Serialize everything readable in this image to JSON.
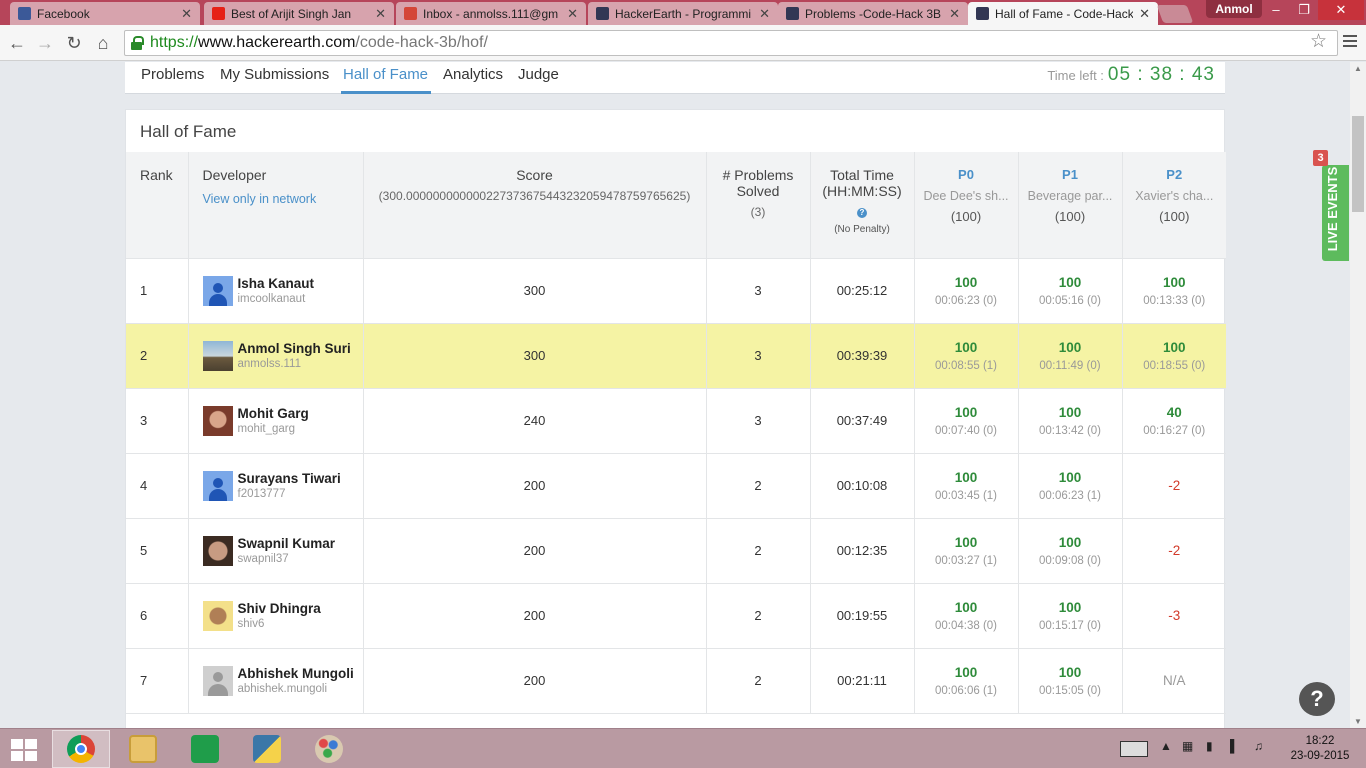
{
  "browser": {
    "tabs": [
      {
        "title": "Facebook",
        "favicon": "facebook-icon",
        "color": "#3b5998",
        "active": false
      },
      {
        "title": "Best of Arijit Singh Jan",
        "favicon": "youtube-icon",
        "color": "#e62117",
        "active": false
      },
      {
        "title": "Inbox - anmolss.111@gm",
        "favicon": "gmail-icon",
        "color": "#d44638",
        "active": false
      },
      {
        "title": "HackerEarth - Programmi",
        "favicon": "hackerearth-icon",
        "color": "#323754",
        "active": false
      },
      {
        "title": "Problems -Code-Hack 3B",
        "favicon": "hackerearth-icon",
        "color": "#323754",
        "active": false
      },
      {
        "title": "Hall of Fame - Code-Hack",
        "favicon": "hackerearth-icon",
        "color": "#323754",
        "active": true
      }
    ],
    "user": "Anmol",
    "url": {
      "scheme": "https://",
      "host": "www.hackerearth.com",
      "path": "/code-hack-3b/hof/"
    }
  },
  "nav": {
    "links": [
      "Problems",
      "My Submissions",
      "Hall of Fame",
      "Analytics",
      "Judge"
    ],
    "active_index": 2,
    "time_left_label": "Time left :",
    "time_left": "05 : 38 : 43"
  },
  "hof": {
    "title": "Hall of Fame",
    "headers": {
      "rank": "Rank",
      "developer": "Developer",
      "view_network": "View only in network",
      "score": "Score",
      "score_max": "(300.000000000000227373675443232059478759765625)",
      "solved": "# Problems Solved",
      "solved_max": "(3)",
      "total_time": "Total Time (HH:MM:SS)",
      "penalty": "(No Penalty)"
    },
    "problems": [
      {
        "code": "P0",
        "name": "Dee Dee's sh...",
        "max": "(100)"
      },
      {
        "code": "P1",
        "name": "Beverage par...",
        "max": "(100)"
      },
      {
        "code": "P2",
        "name": "Xavier's cha...",
        "max": "(100)"
      }
    ],
    "rows": [
      {
        "rank": "1",
        "name": "Isha Kanaut",
        "handle": "imcoolkanaut",
        "avatar": "default-avatar",
        "score": "300",
        "solved": "3",
        "time": "00:25:12",
        "highlight": false,
        "p": [
          {
            "s": "100",
            "t": "00:06:23 (0)"
          },
          {
            "s": "100",
            "t": "00:05:16 (0)"
          },
          {
            "s": "100",
            "t": "00:13:33 (0)"
          }
        ]
      },
      {
        "rank": "2",
        "name": "Anmol Singh Suri",
        "handle": "anmolss.111",
        "avatar": "photo1",
        "score": "300",
        "solved": "3",
        "time": "00:39:39",
        "highlight": true,
        "p": [
          {
            "s": "100",
            "t": "00:08:55 (1)"
          },
          {
            "s": "100",
            "t": "00:11:49 (0)"
          },
          {
            "s": "100",
            "t": "00:18:55 (0)"
          }
        ]
      },
      {
        "rank": "3",
        "name": "Mohit Garg",
        "handle": "mohit_garg",
        "avatar": "photo2",
        "score": "240",
        "solved": "3",
        "time": "00:37:49",
        "highlight": false,
        "p": [
          {
            "s": "100",
            "t": "00:07:40 (0)"
          },
          {
            "s": "100",
            "t": "00:13:42 (0)"
          },
          {
            "s": "40",
            "t": "00:16:27 (0)"
          }
        ]
      },
      {
        "rank": "4",
        "name": "Surayans Tiwari",
        "handle": "f2013777",
        "avatar": "default-avatar",
        "score": "200",
        "solved": "2",
        "time": "00:10:08",
        "highlight": false,
        "p": [
          {
            "s": "100",
            "t": "00:03:45 (1)"
          },
          {
            "s": "100",
            "t": "00:06:23 (1)"
          },
          {
            "s": "-2",
            "t": ""
          }
        ]
      },
      {
        "rank": "5",
        "name": "Swapnil Kumar",
        "handle": "swapnil37",
        "avatar": "photo3",
        "score": "200",
        "solved": "2",
        "time": "00:12:35",
        "highlight": false,
        "p": [
          {
            "s": "100",
            "t": "00:03:27 (1)"
          },
          {
            "s": "100",
            "t": "00:09:08 (0)"
          },
          {
            "s": "-2",
            "t": ""
          }
        ]
      },
      {
        "rank": "6",
        "name": "Shiv Dhingra",
        "handle": "shiv6",
        "avatar": "photo4",
        "score": "200",
        "solved": "2",
        "time": "00:19:55",
        "highlight": false,
        "p": [
          {
            "s": "100",
            "t": "00:04:38 (0)"
          },
          {
            "s": "100",
            "t": "00:15:17 (0)"
          },
          {
            "s": "-3",
            "t": ""
          }
        ]
      },
      {
        "rank": "7",
        "name": "Abhishek Mungoli",
        "handle": "abhishek.mungoli",
        "avatar": "grey-avatar",
        "score": "200",
        "solved": "2",
        "time": "00:21:11",
        "highlight": false,
        "p": [
          {
            "s": "100",
            "t": "00:06:06 (1)"
          },
          {
            "s": "100",
            "t": "00:15:05 (0)"
          },
          {
            "s": "N/A",
            "t": ""
          }
        ]
      }
    ]
  },
  "widgets": {
    "live_events_label": "LIVE EVENTS",
    "live_events_count": "3",
    "help_icon": "question-icon"
  },
  "taskbar": {
    "apps": [
      "chrome-icon",
      "file-explorer-icon",
      "store-icon",
      "python-icon",
      "paint-icon"
    ],
    "time": "18:22",
    "date": "23-09-2015"
  }
}
